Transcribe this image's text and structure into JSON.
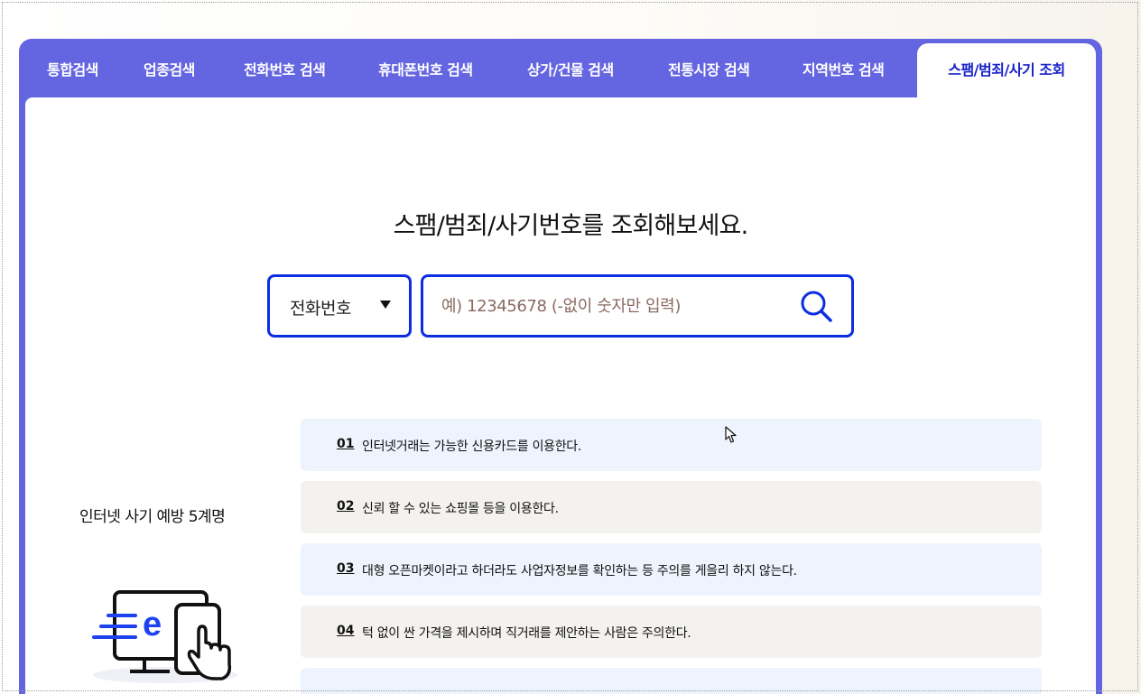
{
  "tabs": [
    {
      "label": "통합검색"
    },
    {
      "label": "업종검색"
    },
    {
      "label": "전화번호 검색"
    },
    {
      "label": "휴대폰번호 검색"
    },
    {
      "label": "상가/건물 검색"
    },
    {
      "label": "전통시장 검색"
    },
    {
      "label": "지역번호 검색"
    },
    {
      "label": "스팸/범죄/사기 조회",
      "active": true
    }
  ],
  "search": {
    "headline": "스팸/범죄/사기번호를 조회해보세요.",
    "select_value": "전화번호",
    "placeholder": "예) 12345678 (-없이 숫자만 입력)",
    "icon": "search-icon"
  },
  "tips": {
    "title": "인터넷 사기 예방 5계명",
    "items": [
      {
        "num": "01",
        "text": "인터넷거래는 가능한 신용카드를 이용한다."
      },
      {
        "num": "02",
        "text": "신뢰 할 수 있는 쇼핑몰 등을 이용한다."
      },
      {
        "num": "03",
        "text": "대형 오픈마켓이라고 하더라도 사업자정보를 확인하는 등 주의를 게을리 하지 않는다."
      },
      {
        "num": "04",
        "text": "턱 없이 싼 가격을 제시하며 직거래를 제안하는 사람은 주의한다."
      },
      {
        "num": "",
        "text": ""
      }
    ]
  },
  "colors": {
    "panel": "#6465e0",
    "accent": "#0b2fe0",
    "active_tab_text": "#1a22c9",
    "tip_blue": "#edf4fd",
    "tip_beige": "#f4f2ee"
  }
}
